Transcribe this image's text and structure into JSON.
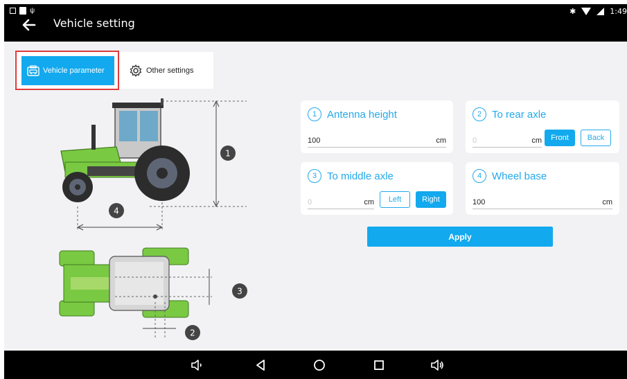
{
  "header": {
    "title": "Vehicle setting",
    "time": "1:49"
  },
  "tabs": [
    {
      "label": "Vehicle parameter",
      "icon": "vehicle-icon",
      "active": true
    },
    {
      "label": "Other settings",
      "icon": "gear-icon",
      "active": false
    }
  ],
  "diagram": {
    "markers": [
      "1",
      "4",
      "3",
      "2"
    ]
  },
  "params": {
    "antenna_height": {
      "num": "1",
      "label": "Antenna height",
      "value": "100",
      "unit": "cm"
    },
    "rear_axle": {
      "num": "2",
      "label": "To rear axle",
      "placeholder": "0",
      "unit": "cm",
      "front": "Front",
      "back": "Back"
    },
    "middle_axle": {
      "num": "3",
      "label": "To middle axle",
      "placeholder": "0",
      "unit": "cm",
      "left": "Left",
      "right": "Right"
    },
    "wheel_base": {
      "num": "4",
      "label": "Wheel base",
      "value": "100",
      "unit": "cm"
    }
  },
  "apply_label": "Apply",
  "colors": {
    "accent": "#12a9ee",
    "highlight": "#e03a3a",
    "tractor": "#7ac943"
  }
}
